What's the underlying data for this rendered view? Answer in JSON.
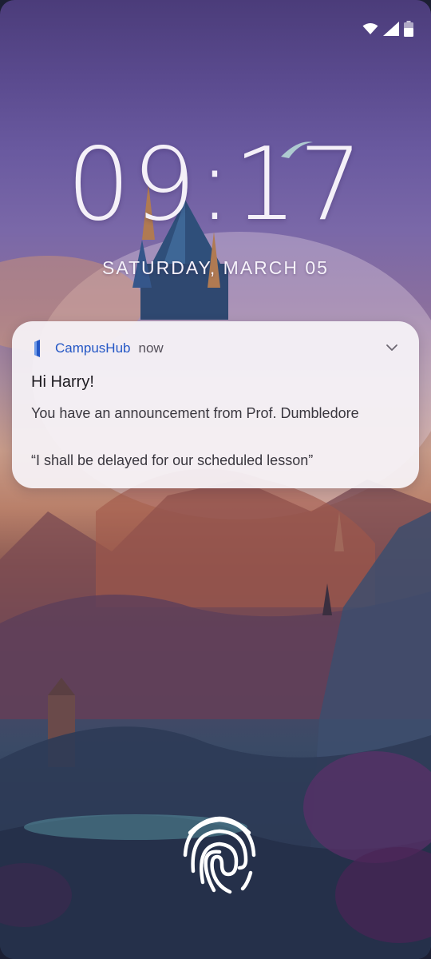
{
  "status_bar": {
    "icons": [
      "wifi-icon",
      "cellular-signal-icon",
      "battery-icon"
    ]
  },
  "lockscreen": {
    "time": "09:17",
    "date": "SATURDAY, MARCH 05"
  },
  "notification": {
    "app_name": "CampusHub",
    "time": "now",
    "title": "Hi Harry!",
    "body": "You have an announcement from Prof. Dumbledore",
    "quote": "“I shall be delayed for our scheduled lesson”",
    "accent_color": "#2457c5"
  },
  "unlock": {
    "icon": "fingerprint-icon"
  }
}
